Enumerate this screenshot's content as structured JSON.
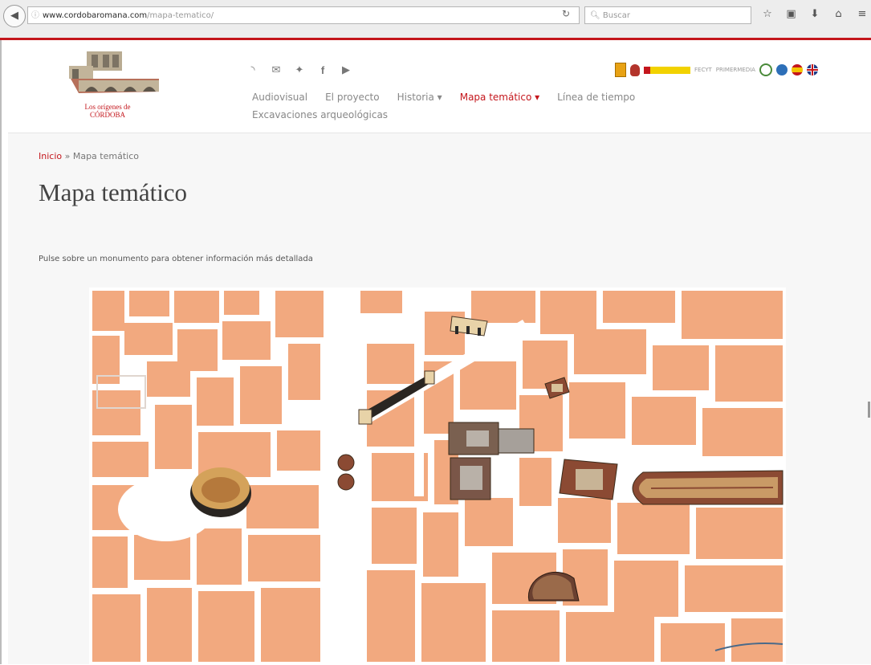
{
  "browser": {
    "url_domain": "www.cordobaromana.com",
    "url_path": "/mapa-tematico/",
    "search_placeholder": "Buscar"
  },
  "header": {
    "logo_text_line1": "Los orígenes de",
    "logo_text_line2": "CÓRDOBA",
    "nav": {
      "items": [
        {
          "label": "Audiovisual"
        },
        {
          "label": "El proyecto"
        },
        {
          "label": "Historia ▾"
        },
        {
          "label": "Mapa temático ▾"
        },
        {
          "label": "Línea de tiempo"
        }
      ],
      "second_row": "Excavaciones arqueológicas"
    },
    "partner_texts": [
      "FECYT",
      "PRIMERMEDIA"
    ]
  },
  "content": {
    "breadcrumb_home": "Inicio",
    "breadcrumb_separator": "»",
    "breadcrumb_current": "Mapa temático",
    "title": "Mapa temático",
    "instruction": "Pulse sobre un monumento para obtener información más detallada"
  },
  "colors": {
    "accent": "#c4161c",
    "map_block": "#f2a97f",
    "map_street": "#ffffff"
  },
  "icons": {
    "toolbar": [
      "star-icon",
      "reading-list-icon",
      "download-icon",
      "home-icon",
      "menu-icon"
    ],
    "social": [
      "rss-icon",
      "mail-icon",
      "twitter-icon",
      "facebook-icon",
      "youtube-icon"
    ]
  }
}
